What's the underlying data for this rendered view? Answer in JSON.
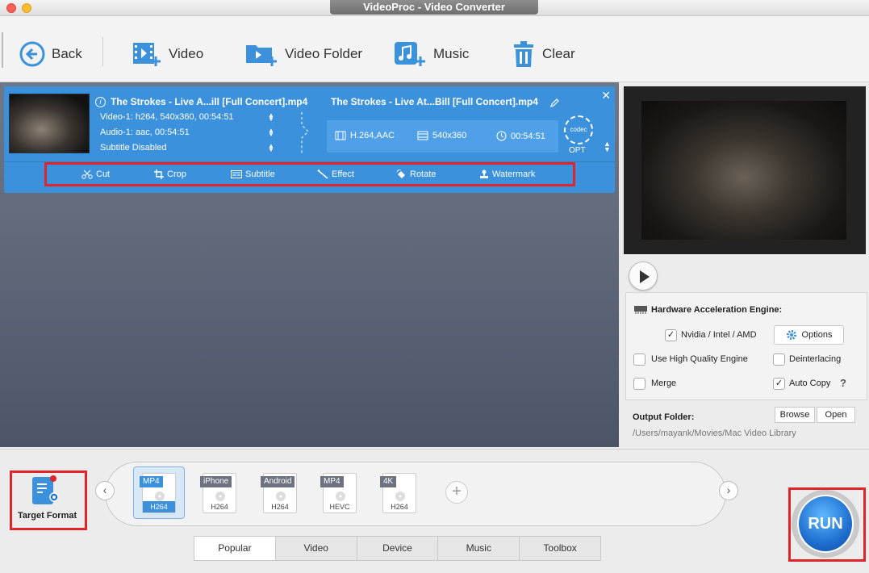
{
  "window": {
    "title": "VideoProc - Video Converter"
  },
  "toolbar": {
    "back": "Back",
    "video": "Video",
    "video_folder": "Video Folder",
    "music": "Music",
    "clear": "Clear"
  },
  "file": {
    "source_name": "The Strokes - Live A...ill [Full Concert].mp4",
    "video_track": "Video-1: h264, 540x360, 00:54:51",
    "audio_track": "Audio-1: aac, 00:54:51",
    "subtitle": "Subtitle Disabled",
    "output_name": "The Strokes - Live At...Bill [Full Concert].mp4",
    "output_codec": "H.264,AAC",
    "output_resolution": "540x360",
    "output_duration": "00:54:51",
    "codec_badge": "codec",
    "opt_label": "OPT"
  },
  "edit_tools": [
    "Cut",
    "Crop",
    "Subtitle",
    "Effect",
    "Rotate",
    "Watermark"
  ],
  "hardware": {
    "title": "Hardware Acceleration Engine:",
    "nvidia_label": "Nvidia / Intel / AMD",
    "nvidia_checked": true,
    "options_label": "Options",
    "high_quality_label": "Use High Quality Engine",
    "high_quality_checked": false,
    "deinterlacing_label": "Deinterlacing",
    "deinterlacing_checked": false,
    "merge_label": "Merge",
    "merge_checked": false,
    "autocopy_label": "Auto Copy",
    "autocopy_checked": true,
    "help_mark": "?"
  },
  "output_folder": {
    "title": "Output Folder:",
    "path": "/Users/mayank/Movies/Mac Video Library",
    "browse": "Browse",
    "open": "Open"
  },
  "target_format": {
    "label": "Target Format"
  },
  "formats": [
    {
      "top": "MP4",
      "bottom": "H264",
      "selected": true
    },
    {
      "top": "iPhone",
      "bottom": "H264",
      "selected": false
    },
    {
      "top": "Android",
      "bottom": "H264",
      "selected": false
    },
    {
      "top": "MP4",
      "bottom": "HEVC",
      "selected": false
    },
    {
      "top": "4K",
      "bottom": "H264",
      "selected": false
    }
  ],
  "tabs": [
    "Popular",
    "Video",
    "Device",
    "Music",
    "Toolbox"
  ],
  "active_tab": "Popular",
  "run": {
    "label": "RUN"
  },
  "colors": {
    "accent": "#3c91dd",
    "highlight": "#e0242a"
  }
}
